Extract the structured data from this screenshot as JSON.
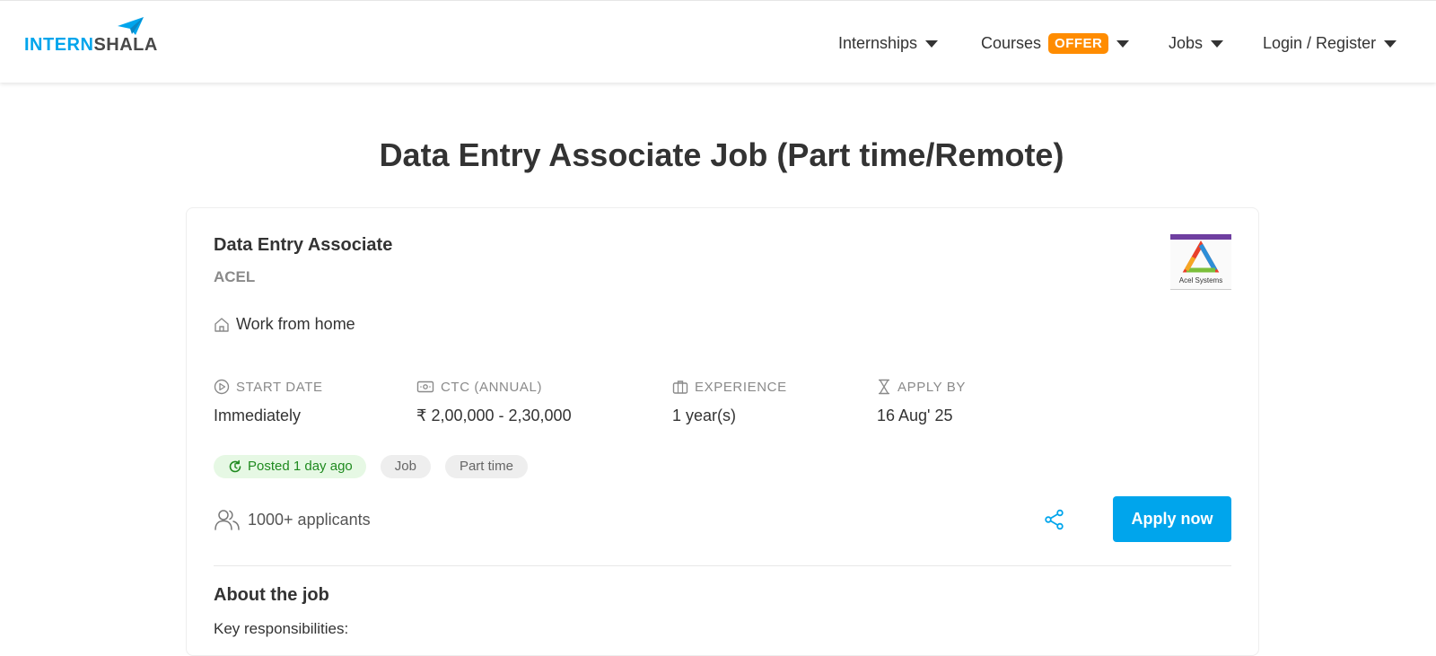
{
  "header": {
    "logo": {
      "part1": "INTERN",
      "part2": "SHALA"
    },
    "nav": {
      "internships": "Internships",
      "courses": "Courses",
      "courses_badge": "OFFER",
      "jobs": "Jobs",
      "login": "Login / Register"
    }
  },
  "page": {
    "title": "Data Entry Associate Job (Part time/Remote)"
  },
  "job": {
    "role": "Data Entry Associate",
    "company": "ACEL",
    "company_logo_text": "Acel Systems",
    "location": "Work from home",
    "meta": {
      "start_date": {
        "label": "START DATE",
        "value": "Immediately"
      },
      "ctc": {
        "label": "CTC (ANNUAL)",
        "value": "₹ 2,00,000 - 2,30,000"
      },
      "experience": {
        "label": "EXPERIENCE",
        "value": "1 year(s)"
      },
      "apply_by": {
        "label": "APPLY BY",
        "value": "16 Aug' 25"
      }
    },
    "tags": {
      "posted": "Posted 1 day ago",
      "type": "Job",
      "schedule": "Part time"
    },
    "applicants": "1000+ applicants",
    "apply_label": "Apply now",
    "about_heading": "About the job",
    "key_responsibilities": "Key responsibilities:"
  },
  "colors": {
    "brand_blue": "#00a5ec",
    "offer_orange": "#ff8c00",
    "posted_green": "#1f8a1f"
  },
  "icons": [
    "paper-plane-icon",
    "caret-down-icon",
    "home-icon",
    "play-circle-icon",
    "money-icon",
    "briefcase-icon",
    "hourglass-icon",
    "refresh-icon",
    "people-icon",
    "share-icon"
  ]
}
